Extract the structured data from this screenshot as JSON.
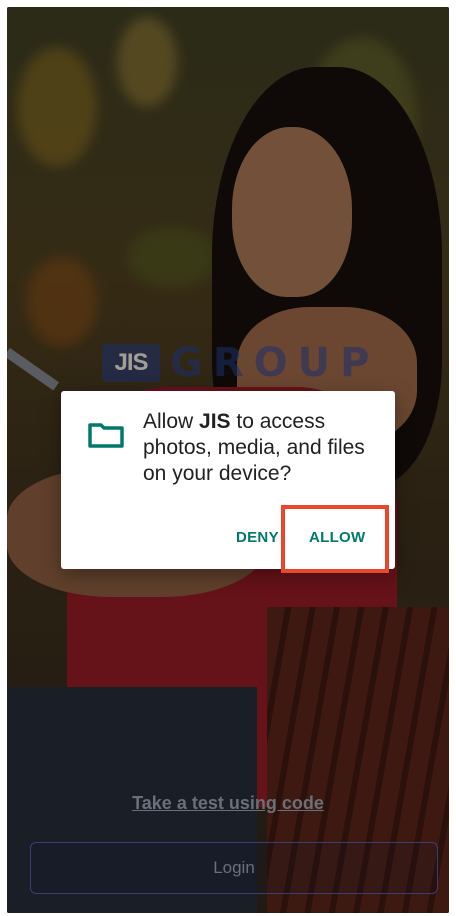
{
  "app": {
    "brand_mark": "JIS",
    "brand_word": "GROUP"
  },
  "dialog": {
    "message_prefix": "Allow ",
    "app_name": "JIS",
    "message_suffix": " to access photos, media, and files on your device?",
    "deny_label": "DENY",
    "allow_label": "ALLOW",
    "icon": "folder-icon"
  },
  "bottom": {
    "code_link": "Take a test using code",
    "login_label": "Login"
  },
  "colors": {
    "accent": "#00796b",
    "highlight": "#e8472b",
    "brand": "#1c2f6b"
  }
}
